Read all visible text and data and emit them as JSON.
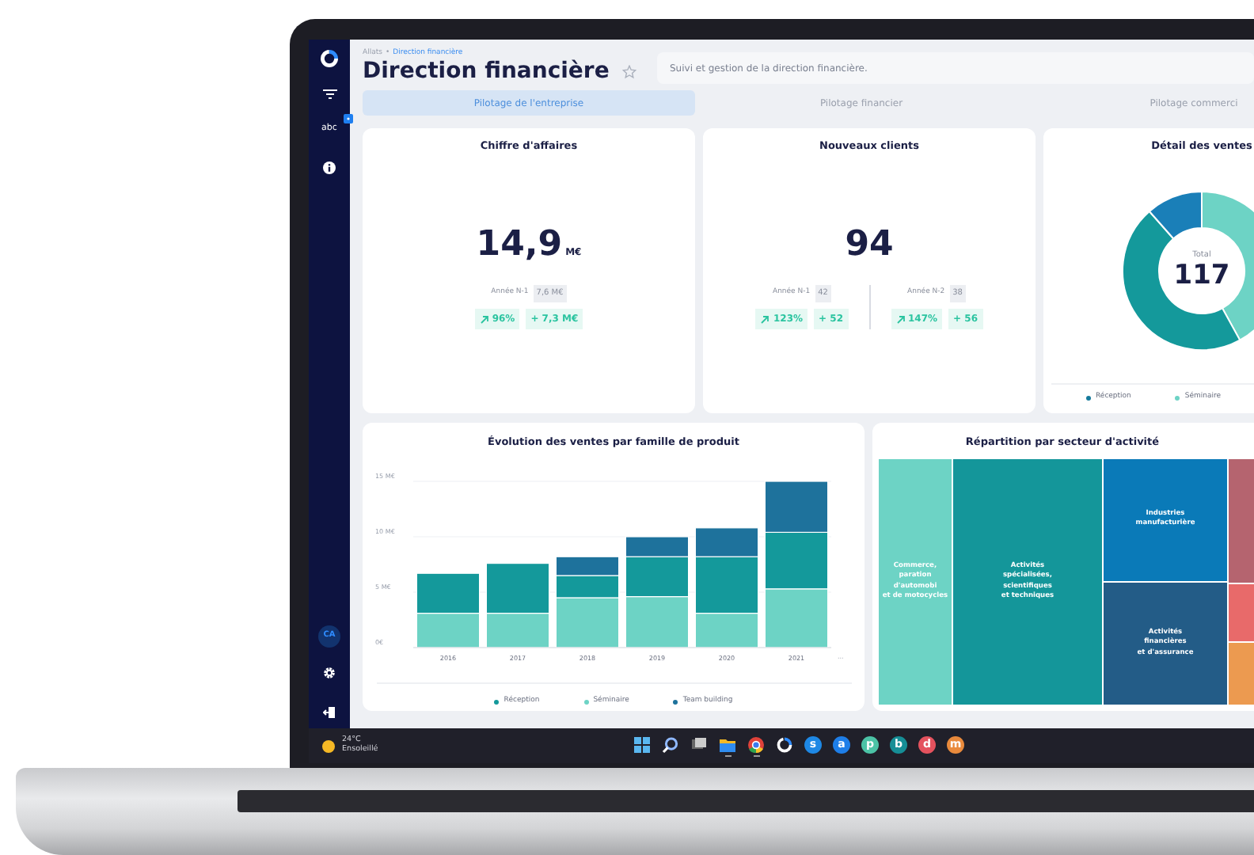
{
  "sidebar": {
    "label": "abc",
    "avatar": "CA"
  },
  "header": {
    "breadcrumb": [
      "Allats",
      "Direction financière"
    ],
    "breadcrumb_separator": "•",
    "title": "Direction financière",
    "starred": false,
    "description": "Suivi et gestion de la direction financière."
  },
  "tabs": [
    {
      "label": "Pilotage de l'entreprise",
      "selected": true
    },
    {
      "label": "Pilotage financier",
      "selected": false
    },
    {
      "label": "Pilotage commerci",
      "selected": false
    }
  ],
  "kpis": [
    {
      "title": "Chiffre d'affaires",
      "value": "14,9",
      "unit": "M€",
      "comparisons": [
        {
          "label": "Année N-1",
          "value": "7,6 M€",
          "change": "96%",
          "difference": "+ 7,3 M€"
        }
      ]
    },
    {
      "title": "Nouveaux clients",
      "value": "94",
      "comparisons": [
        {
          "label": "Année N-1",
          "value": "42",
          "change": "123%",
          "difference": "+ 52"
        },
        {
          "label": "Année N-2",
          "value": "38",
          "change": "147%",
          "difference": "+ 56"
        }
      ]
    }
  ],
  "sales_detail": {
    "title": "Détail des ventes",
    "total_label": "Total",
    "total": "117",
    "legend": [
      {
        "label": "Réception",
        "color": "#157a9c"
      },
      {
        "label": "Séminaire",
        "color": "#6dd3c5"
      }
    ]
  },
  "sales_chart": {
    "title": "Évolution des ventes par famille de produit",
    "more": "···",
    "chart_data": {
      "type": "bar",
      "stacked": true,
      "categories": [
        "2016",
        "2017",
        "2018",
        "2019",
        "2020",
        "2021"
      ],
      "series": [
        {
          "name": "Réception",
          "color": "#14999b",
          "values": [
            3.6,
            4.5,
            2.0,
            3.6,
            5.1,
            5.1
          ]
        },
        {
          "name": "Séminaire",
          "color": "#6dd3c5",
          "values": [
            3.1,
            3.1,
            4.5,
            4.6,
            3.1,
            5.3
          ]
        },
        {
          "name": "Team building",
          "color": "#1e729c",
          "values": [
            0,
            0,
            1.7,
            1.8,
            2.6,
            4.6
          ]
        }
      ],
      "grid": true,
      "ylim": [
        0,
        15
      ],
      "yticks": [
        {
          "value": 0,
          "label": "0€"
        },
        {
          "value": 5,
          "label": "5 M€"
        },
        {
          "value": 10,
          "label": "10 M€"
        },
        {
          "value": 15,
          "label": "15 M€"
        }
      ]
    }
  },
  "sector_chart": {
    "title": "Répartition par secteur d'activité",
    "tiles": [
      {
        "label": "Commerce,\nparation d'automobi\net de motocycles",
        "color": "#6dd3c5"
      },
      {
        "label": "Activités\nspécialisées,\nscientifiques\net techniques",
        "color": "#14969a"
      },
      {
        "label": "Industries\nmanufacturière",
        "color": "#0a7ab8"
      },
      {
        "label": "Activités\nfinancières\net d'assurance",
        "color": "#235c87"
      },
      {
        "color": "#b5646f"
      },
      {
        "color": "#e86a6a"
      },
      {
        "color": "#ec9a50"
      }
    ]
  },
  "taskbar": {
    "temperature": "24°C",
    "weather": "Ensoleillé",
    "apps": [
      {
        "kind": "start",
        "running": false
      },
      {
        "kind": "search",
        "running": false
      },
      {
        "kind": "taskview",
        "running": false
      },
      {
        "kind": "folder",
        "running": true
      },
      {
        "kind": "browser",
        "running": true
      },
      {
        "kind": "sync",
        "running": false
      },
      {
        "kind": "letter",
        "letter": "s",
        "color": "#1e88e5",
        "running": false
      },
      {
        "kind": "letter",
        "letter": "a",
        "color": "#1e7ee8",
        "running": false
      },
      {
        "kind": "letter",
        "letter": "p",
        "color": "#4cc3a6",
        "running": false
      },
      {
        "kind": "letter",
        "letter": "b",
        "color": "#168e96",
        "running": false
      },
      {
        "kind": "letter",
        "letter": "d",
        "color": "#e4525e",
        "running": false
      },
      {
        "kind": "letter",
        "letter": "m",
        "color": "#e98a3c",
        "running": false
      }
    ]
  }
}
